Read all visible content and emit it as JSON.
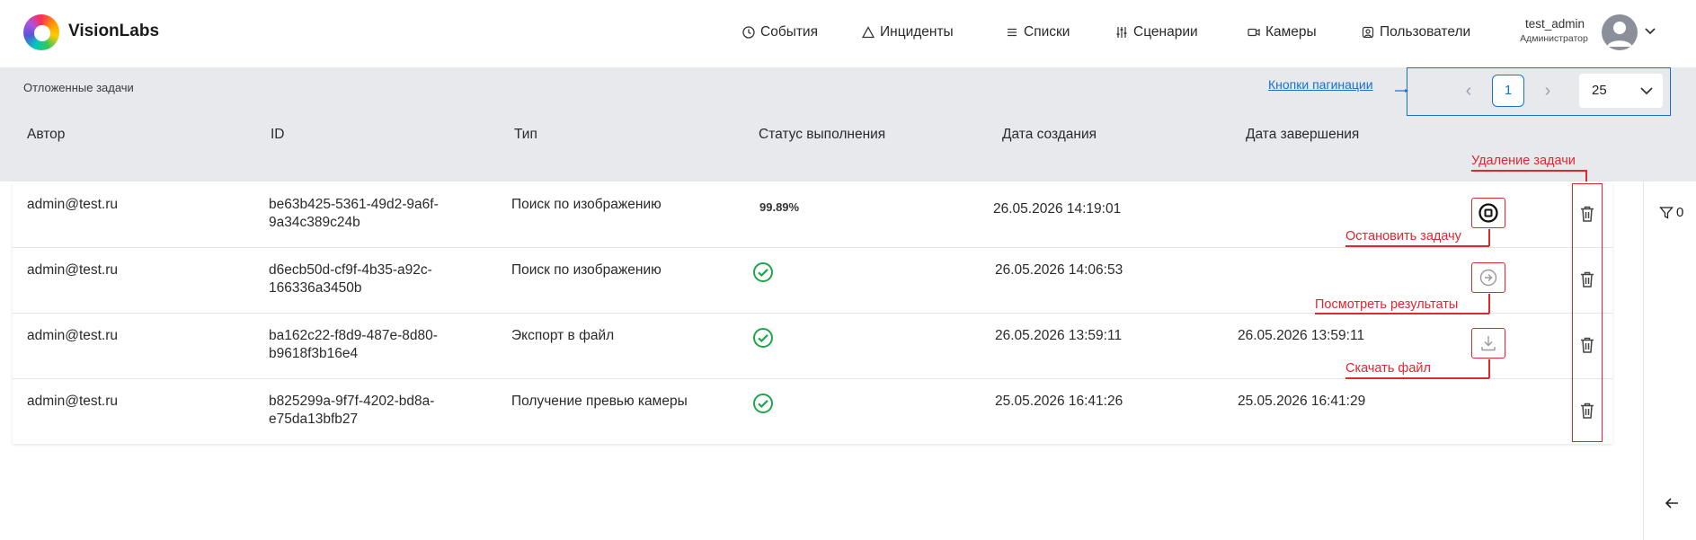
{
  "brand": "VisionLabs",
  "nav": [
    {
      "label": "События",
      "icon": "clock-icon"
    },
    {
      "label": "Инциденты",
      "icon": "warning-icon"
    },
    {
      "label": "Списки",
      "icon": "list-icon"
    },
    {
      "label": "Сценарии",
      "icon": "sliders-icon"
    },
    {
      "label": "Камеры",
      "icon": "camera-icon"
    },
    {
      "label": "Пользователи",
      "icon": "users-icon"
    }
  ],
  "user": {
    "name": "test_admin",
    "role": "Администратор"
  },
  "breadcrumb": "Отложенные задачи",
  "pagination": {
    "label": "Кнопки пагинации",
    "page": "1",
    "page_size": "25"
  },
  "columns": [
    "Автор",
    "ID",
    "Тип",
    "Статус выполнения",
    "Дата создания",
    "Дата завершения"
  ],
  "rows": [
    {
      "author": "admin@test.ru",
      "id_line1": "be63b425-5361-49d2-9a6f-",
      "id_line2": "9a34c389c24b",
      "type": "Поиск по изображению",
      "status": "99.89%",
      "created": "26.05.2026 14:19:01",
      "finished": "",
      "action": "stop-icon"
    },
    {
      "author": "admin@test.ru",
      "id_line1": "d6ecb50d-cf9f-4b35-a92c-",
      "id_line2": "166336a3450b",
      "type": "Поиск по изображению",
      "status": "done",
      "created": "26.05.2026 14:06:53",
      "finished": "",
      "action": "view-results-icon"
    },
    {
      "author": "admin@test.ru",
      "id_line1": "ba162c22-f8d9-487e-8d80-",
      "id_line2": "b9618f3b16e4",
      "type": "Экспорт в файл",
      "status": "done",
      "created": "26.05.2026 13:59:11",
      "finished": "26.05.2026 13:59:11",
      "action": "download-icon"
    },
    {
      "author": "admin@test.ru",
      "id_line1": "b825299a-9f7f-4202-bd8a-",
      "id_line2": "e75da13bfb27",
      "type": "Получение превью камеры",
      "status": "done",
      "created": "25.05.2026 16:41:26",
      "finished": "25.05.2026 16:41:29",
      "action": ""
    }
  ],
  "annotations": {
    "delete": "Удаление задачи",
    "stop": "Остановить задачу",
    "view": "Посмотреть результаты",
    "download": "Скачать файл"
  },
  "filter_count": "0",
  "colors": {
    "accent": "#1a6fd1",
    "annotation": "#e0262f",
    "success": "#1fa64a"
  }
}
